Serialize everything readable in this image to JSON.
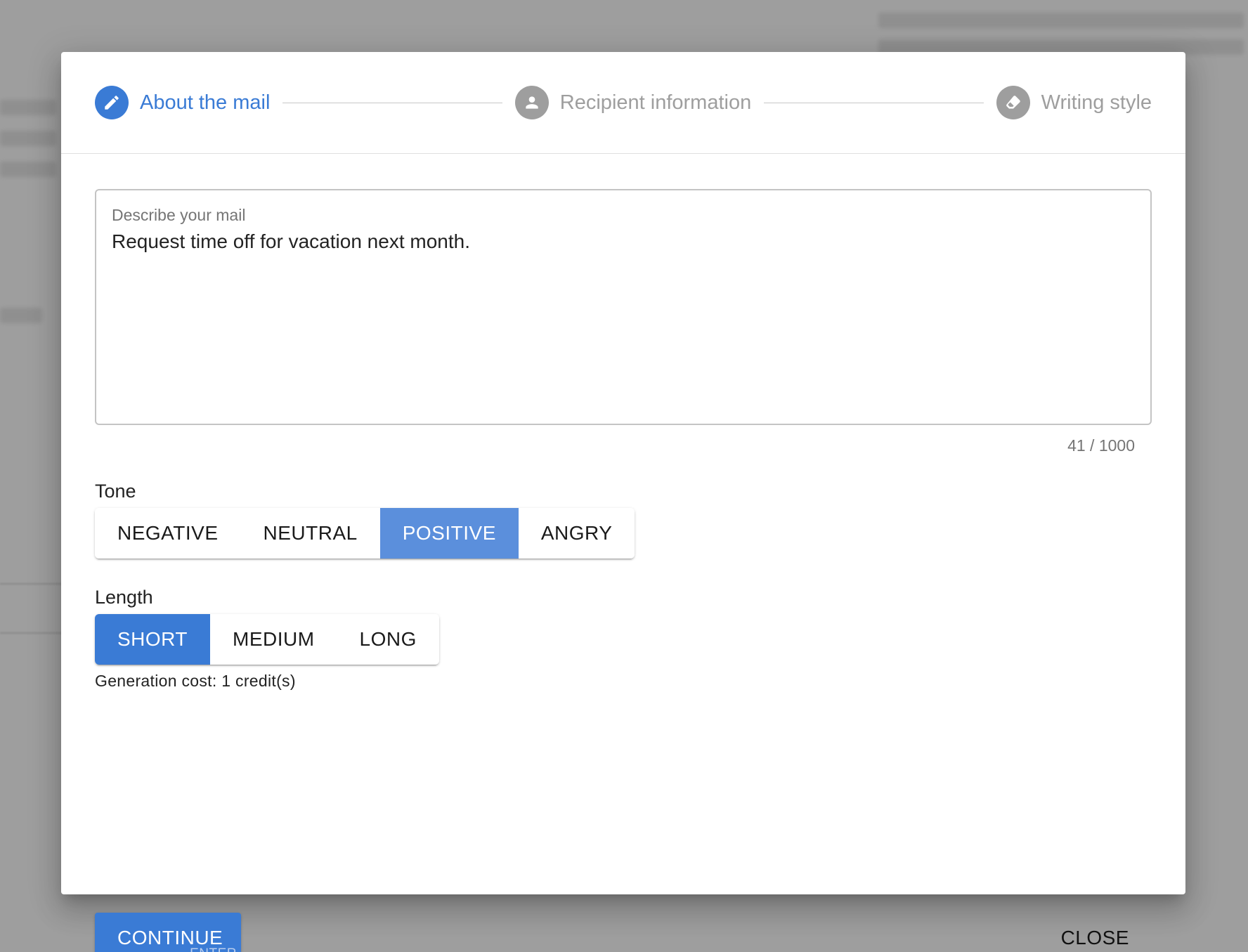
{
  "stepper": {
    "steps": [
      {
        "label": "About the mail",
        "icon": "pencil-icon",
        "state": "active"
      },
      {
        "label": "Recipient information",
        "icon": "person-icon",
        "state": "inactive"
      },
      {
        "label": "Writing style",
        "icon": "eraser-icon",
        "state": "inactive"
      }
    ]
  },
  "description": {
    "label": "Describe your mail",
    "value": "Request time off for vacation next month.",
    "counter": "41 / 1000"
  },
  "tone": {
    "label": "Tone",
    "options": [
      "NEGATIVE",
      "NEUTRAL",
      "POSITIVE",
      "ANGRY"
    ],
    "selected": "POSITIVE"
  },
  "length": {
    "label": "Length",
    "options": [
      "SHORT",
      "MEDIUM",
      "LONG"
    ],
    "selected": "SHORT"
  },
  "cost": "Generation cost: 1 credit(s)",
  "footer": {
    "continue_label": "CONTINUE",
    "continue_hint": "ENTER",
    "close_label": "CLOSE"
  },
  "colors": {
    "accent": "#3a7bd5",
    "inactive": "#9e9e9e",
    "backdrop": "#9e9e9e"
  }
}
